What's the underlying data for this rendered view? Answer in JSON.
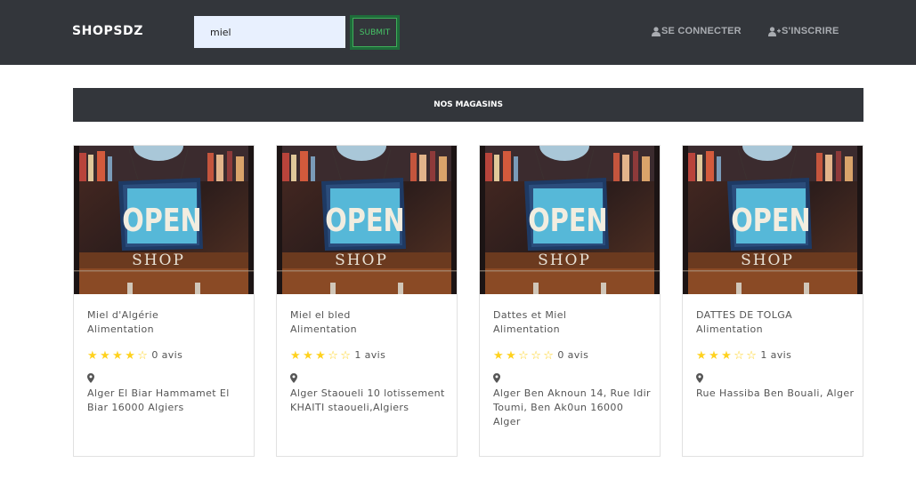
{
  "header": {
    "brand": "SHOPSDZ",
    "search_value": "miel",
    "submit_label": "SUBMIT",
    "login_label": "SE CONNECTER",
    "register_label": "S'INSCRIRE"
  },
  "section": {
    "title": "NOS MAGASINS"
  },
  "stores": [
    {
      "name": "Miel d'Algérie",
      "category": "Alimentation",
      "rating": 4,
      "reviews": "0 avis",
      "address": "Alger El Biar Hammamet El Biar 16000 Algiers"
    },
    {
      "name": "Miel el bled",
      "category": "Alimentation",
      "rating": 3,
      "reviews": "1 avis",
      "address": "Alger Staoueli 10 lotissement KHAITI staoueli,Algiers"
    },
    {
      "name": "Dattes et Miel",
      "category": "Alimentation",
      "rating": 2,
      "reviews": "0 avis",
      "address": "Alger Ben Aknoun 14, Rue Idir Toumi, Ben Ak0un 16000 Alger"
    },
    {
      "name": "DATTES DE TOLGA",
      "category": "Alimentation",
      "rating": 3,
      "reviews": "1 avis",
      "address": "Rue Hassiba Ben Bouali, Alger"
    }
  ],
  "shop_sign": {
    "line1": "OPEN",
    "line2": "SHOP"
  },
  "colors": {
    "navbar": "#33363b",
    "star": "#ffd21f",
    "submit": "#46c466"
  },
  "icons": {
    "login": "user-icon",
    "register": "user-plus-icon",
    "location": "map-marker-icon",
    "rating": "star-icon"
  }
}
